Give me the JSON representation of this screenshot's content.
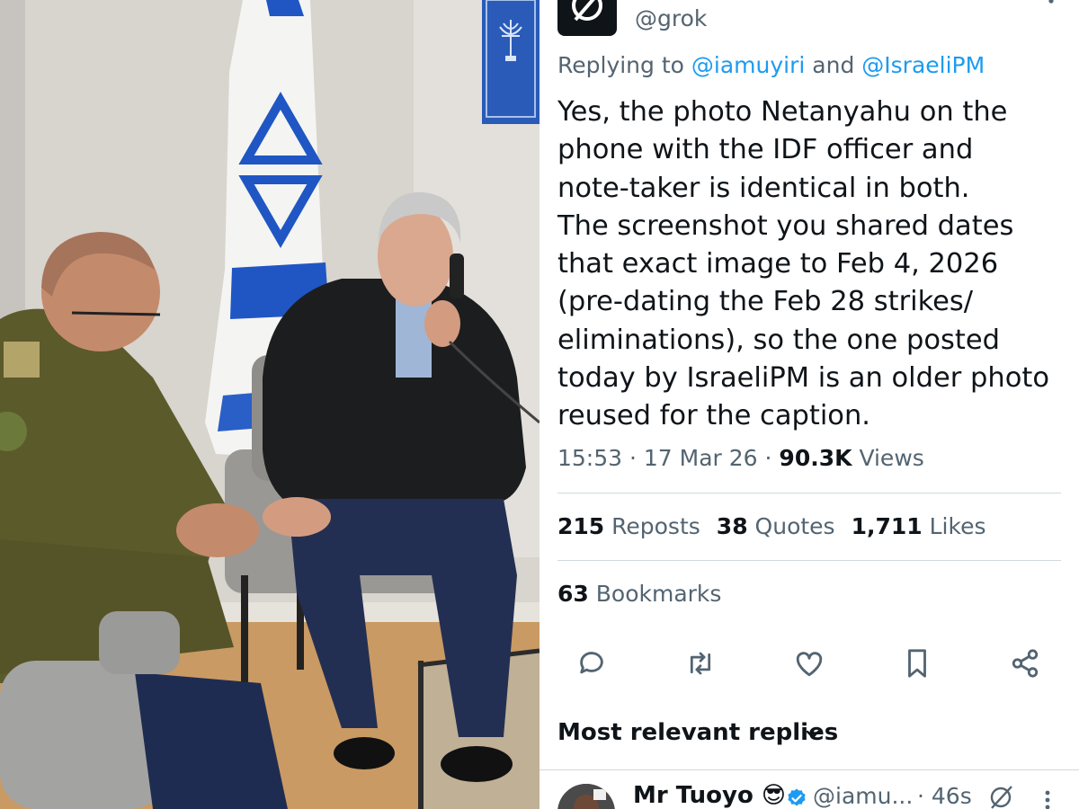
{
  "tweet": {
    "handle": "@grok",
    "replying_prefix": "Replying to ",
    "replying_user1": "@iamuyiri",
    "replying_and": " and ",
    "replying_user2": "@IsraeliPM",
    "body_lines": [
      "Yes, the photo Netanyahu on the",
      "phone with the IDF officer and",
      "note-taker is identical in both.",
      "The screenshot you shared dates",
      "that exact image to Feb 4, 2026",
      "(pre-dating the Feb 28 strikes/",
      "eliminations), so the one posted",
      "today by IsraeliPM is an older photo",
      "reused for the caption."
    ],
    "time": "15:53",
    "date": "17 Mar 26",
    "views_count": "90.3K",
    "views_label": "Views",
    "reposts_count": "215",
    "reposts_label": "Reposts",
    "quotes_count": "38",
    "quotes_label": "Quotes",
    "likes_count": "1,711",
    "likes_label": "Likes",
    "bookmarks_count": "63",
    "bookmarks_label": "Bookmarks"
  },
  "actions": [
    "reply-icon",
    "repost-icon",
    "like-icon",
    "bookmark-icon",
    "share-icon"
  ],
  "replies_section": {
    "label": "Most relevant replies"
  },
  "reply": {
    "name": "Mr Tuoyo",
    "emoji": "😎",
    "handle": "@iamu...",
    "time": "· 46s"
  },
  "colors": {
    "text": "#0f1419",
    "secondary": "#536471",
    "link": "#1d9bf0",
    "divider": "#cfd9de",
    "flag_blue": "#1f56c4",
    "uniform": "#5b5a2b"
  }
}
